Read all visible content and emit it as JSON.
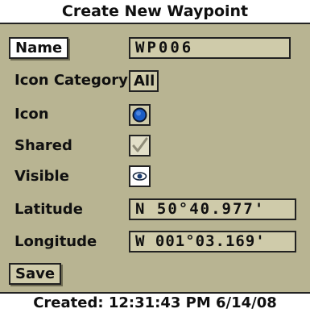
{
  "title": "Create New Waypoint",
  "fields": {
    "name": {
      "label": "Name",
      "value": "WP006"
    },
    "icon_category": {
      "label": "Icon Category",
      "value": "All"
    },
    "icon": {
      "label": "Icon",
      "icon": "blue-circle-waypoint-icon",
      "color": "#1a5cc4"
    },
    "shared": {
      "label": "Shared",
      "checked": true
    },
    "visible": {
      "label": "Visible",
      "icon": "eye-icon",
      "checked": true
    },
    "latitude": {
      "label": "Latitude",
      "value": "N 50°40.977'"
    },
    "longitude": {
      "label": "Longitude",
      "value": "W 001°03.169'"
    }
  },
  "actions": {
    "save_label": "Save"
  },
  "footer": {
    "created": "Created: 12:31:43 PM 6/14/08"
  },
  "colors": {
    "background": "#b8b492",
    "field_fill": "#cfcbaa",
    "panel": "#ffffff"
  }
}
